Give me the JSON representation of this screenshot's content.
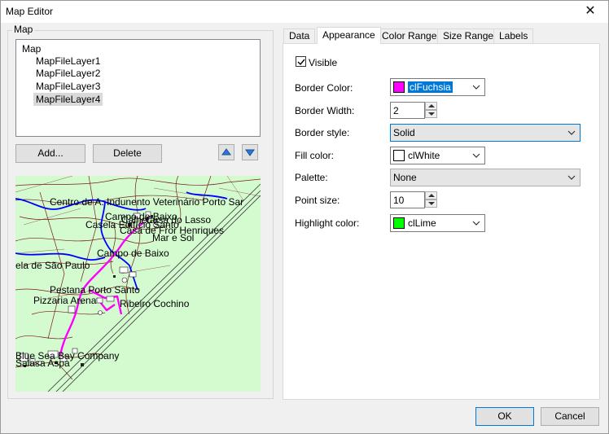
{
  "window": {
    "title": "Map Editor",
    "close_glyph": "✕"
  },
  "map_group": {
    "caption": "Map"
  },
  "tree": {
    "root": "Map",
    "layers": [
      "MapFileLayer1",
      "MapFileLayer2",
      "MapFileLayer3",
      "MapFileLayer4"
    ],
    "selected_index": 3
  },
  "buttons": {
    "add": "Add...",
    "delete": "Delete",
    "move_up_icon": "arrow-up-icon",
    "move_down_icon": "arrow-down-icon"
  },
  "map_preview": {
    "labels": [
      "Centro de A. Indunento Veterinário Porto Sar",
      "Campo de Baixo",
      "Calheta",
      "Casa do Lasso",
      "Casela Edifício Santo",
      "Casa de Fror Henriques",
      "Mar e Sol",
      "Campo de Baixo",
      "ela de São Paulo",
      "Pestana Porto Santo",
      "Pizzaria Arena",
      "Ribeiro Cochino",
      "Blue Sea Bay Company",
      "Salasa Aspa"
    ]
  },
  "tabs": [
    "Data",
    "Appearance",
    "Color Ranges",
    "Size Ranges",
    "Labels"
  ],
  "active_tab": "Appearance",
  "appearance": {
    "visible_label": "Visible",
    "visible_checked": true,
    "border_color": {
      "label": "Border Color:",
      "value": "clFuchsia",
      "swatch": "#ff00ff"
    },
    "border_width": {
      "label": "Border Width:",
      "value": "2"
    },
    "border_style": {
      "label": "Border style:",
      "value": "Solid"
    },
    "fill_color": {
      "label": "Fill color:",
      "value": "clWhite",
      "swatch": "#ffffff"
    },
    "palette": {
      "label": "Palette:",
      "value": "None"
    },
    "point_size": {
      "label": "Point size:",
      "value": "10"
    },
    "highlight_color": {
      "label": "Highlight color:",
      "value": "clLime",
      "swatch": "#00ff00"
    }
  },
  "footer": {
    "ok": "OK",
    "cancel": "Cancel"
  },
  "colors": {
    "accent": "#0078d7",
    "map_bg": "#d4fbd0",
    "road_dark": "#7a1a1a",
    "river": "#0000ff",
    "highlight_path": "#ff00ff"
  }
}
